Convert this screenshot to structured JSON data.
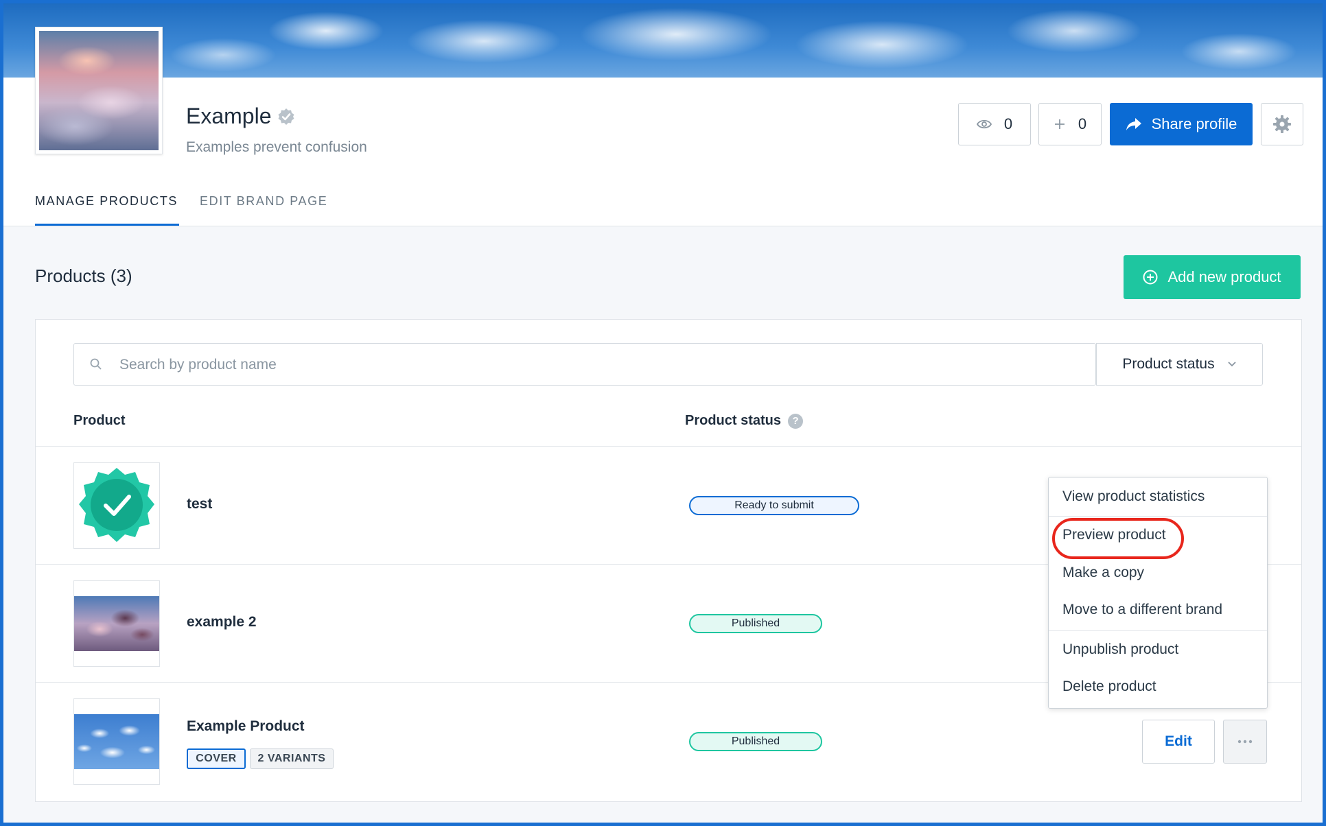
{
  "brand": {
    "name": "Example",
    "tagline": "Examples prevent confusion"
  },
  "header": {
    "views_count": "0",
    "adds_count": "0",
    "share_label": "Share profile"
  },
  "tabs": {
    "manage": "MANAGE PRODUCTS",
    "edit": "EDIT BRAND PAGE"
  },
  "products": {
    "title": "Products (3)",
    "add_label": "Add new product",
    "search_placeholder": "Search by product name",
    "status_filter_label": "Product status",
    "col_product": "Product",
    "col_status": "Product status",
    "rows": [
      {
        "name": "test",
        "status": "Ready to submit"
      },
      {
        "name": "example 2",
        "status": "Published"
      },
      {
        "name": "Example Product",
        "status": "Published",
        "tags": [
          "COVER",
          "2 VARIANTS"
        ],
        "edit_label": "Edit"
      }
    ]
  },
  "menu": {
    "items": [
      "View product statistics",
      "Preview product",
      "Make a copy",
      "Move to a different brand",
      "Unpublish product",
      "Delete product"
    ]
  },
  "colors": {
    "primary": "#0b6bd4",
    "success": "#1ec6a0",
    "highlight": "#e8261c"
  }
}
